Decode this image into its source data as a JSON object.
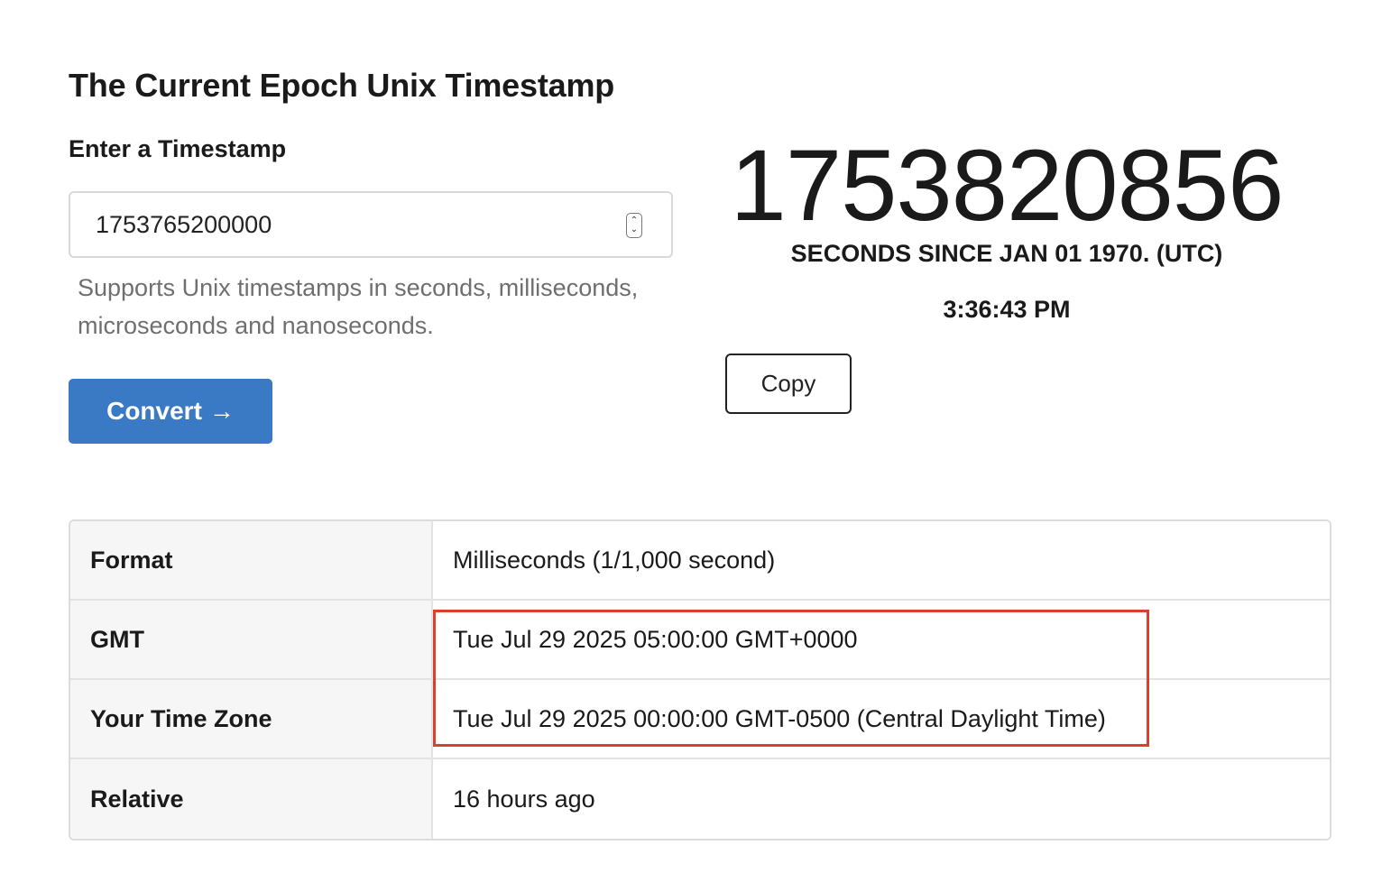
{
  "page": {
    "title": "The Current Epoch Unix Timestamp"
  },
  "converter": {
    "input_label": "Enter a Timestamp",
    "input_value": "1753765200000",
    "helper_text": "Supports Unix timestamps in seconds, milliseconds, microseconds and nanoseconds.",
    "convert_label": "Convert",
    "convert_arrow": "→"
  },
  "current": {
    "epoch": "1753820856",
    "caption": "SECONDS SINCE JAN 01 1970. (UTC)",
    "time": "3:36:43 PM",
    "copy_label": "Copy"
  },
  "results": [
    {
      "key": "Format",
      "value": "Milliseconds (1/1,000 second)"
    },
    {
      "key": "GMT",
      "value": "Tue Jul 29 2025 05:00:00 GMT+0000"
    },
    {
      "key": "Your Time Zone",
      "value": "Tue Jul 29 2025 00:00:00 GMT-0500 (Central Daylight Time)"
    },
    {
      "key": "Relative",
      "value": "16 hours ago"
    }
  ],
  "annotation": {
    "highlight_color": "#d9412f"
  },
  "colors": {
    "primary_button": "#3a7ac4"
  }
}
